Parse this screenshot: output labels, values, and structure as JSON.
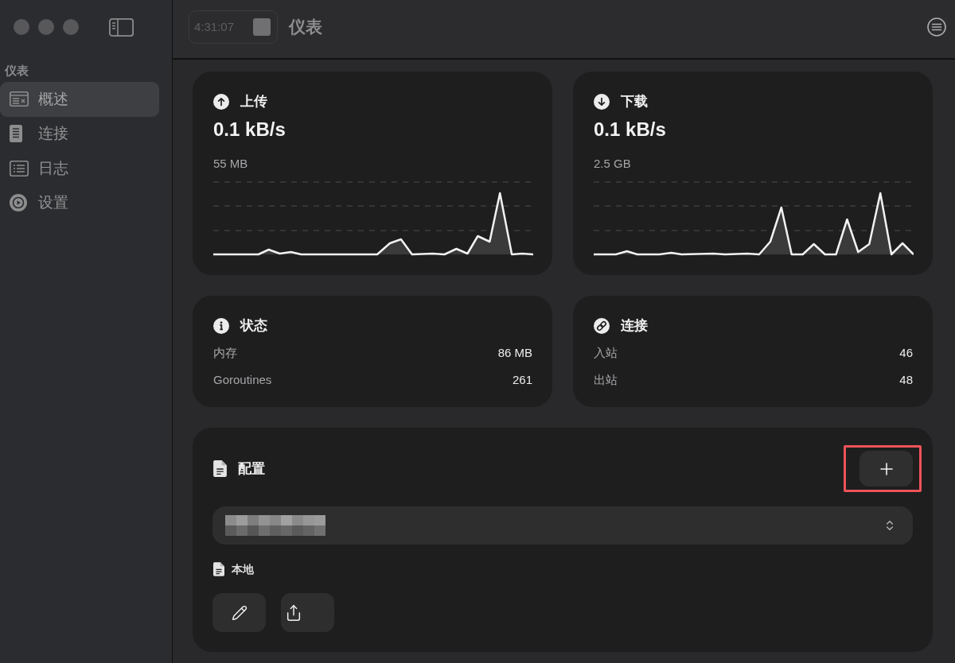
{
  "toolbar": {
    "timer": "4:31:07",
    "title": "仪表"
  },
  "sidebar": {
    "section_title": "仪表",
    "items": [
      {
        "label": "概述",
        "selected": true
      },
      {
        "label": "连接",
        "selected": false
      },
      {
        "label": "日志",
        "selected": false
      },
      {
        "label": "设置",
        "selected": false
      }
    ]
  },
  "traffic_cards": [
    {
      "title": "上传",
      "rate": "0.1 kB/s",
      "total": "55 MB"
    },
    {
      "title": "下载",
      "rate": "0.1 kB/s",
      "total": "2.5 GB"
    }
  ],
  "stat_cards": [
    {
      "title": "状态",
      "rows": [
        {
          "label": "内存",
          "value": "86 MB"
        },
        {
          "label": "Goroutines",
          "value": "261"
        }
      ]
    },
    {
      "title": "连接",
      "rows": [
        {
          "label": "入站",
          "value": "46"
        },
        {
          "label": "出站",
          "value": "48"
        }
      ]
    }
  ],
  "config": {
    "title": "配置",
    "add_button": {
      "highlighted": true
    },
    "profile_select": {
      "redacted": true
    },
    "source": "本地"
  }
}
